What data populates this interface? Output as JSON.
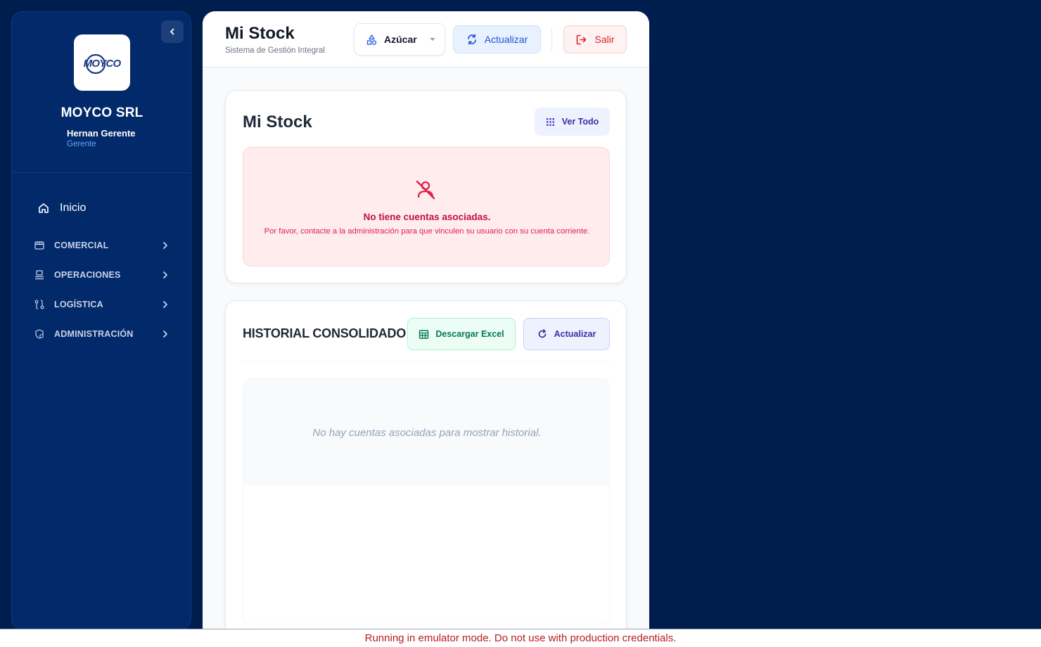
{
  "sidebar": {
    "company_name": "MOYCO SRL",
    "user_name": "Hernan Gerente",
    "user_role": "Gerente",
    "logo_text": "MOYCO",
    "home_label": "Inicio",
    "sections": [
      {
        "label": "COMERCIAL",
        "icon": "store-icon"
      },
      {
        "label": "OPERACIONES",
        "icon": "operations-icon"
      },
      {
        "label": "LOGÍSTICA",
        "icon": "route-icon"
      },
      {
        "label": "ADMINISTRACIÓN",
        "icon": "admin-icon"
      }
    ]
  },
  "header": {
    "title": "Mi Stock",
    "subtitle": "Sistema de Gestión Integral",
    "product_selected": "Azúcar",
    "refresh_label": "Actualizar",
    "logout_label": "Salir"
  },
  "stock_card": {
    "title": "Mi Stock",
    "view_all_label": "Ver Todo",
    "alert_title": "No tiene cuentas asociadas.",
    "alert_text": "Por favor, contacte a la administración para que vinculen su usuario con su cuenta corriente."
  },
  "history_card": {
    "title": "HISTORIAL CONSOLIDADO",
    "excel_label": "Descargar Excel",
    "refresh_label": "Actualizar",
    "empty_message": "No hay cuentas asociadas para mostrar historial."
  },
  "footer": {
    "emulator_notice": "Running in emulator mode. Do not use with production credentials."
  },
  "colors": {
    "background": "#001e4d",
    "sidebar": "#022a6b",
    "accent": "#1d4ed8",
    "danger": "#dc2626",
    "success": "#047857"
  }
}
